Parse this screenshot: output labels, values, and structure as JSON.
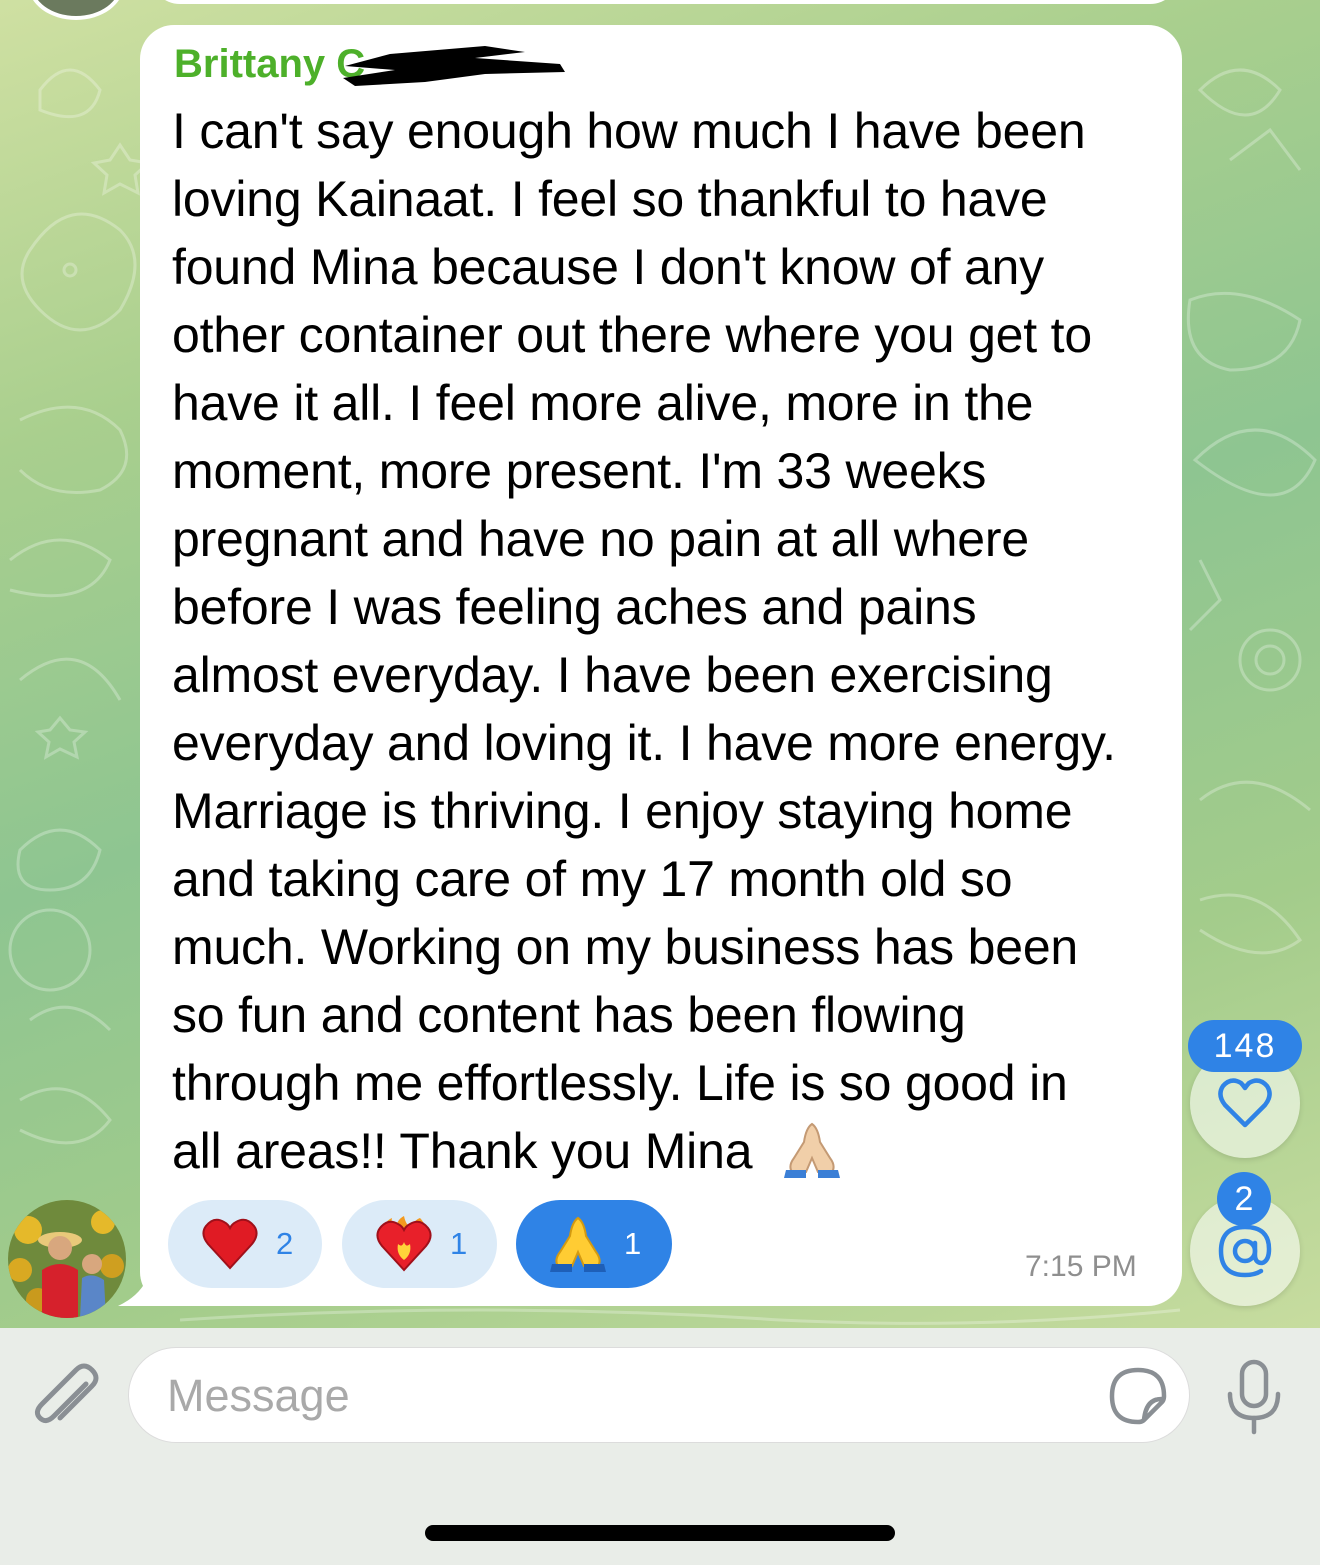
{
  "chat": {
    "message": {
      "sender": "Brittany C",
      "lines": [
        "I can't say enough how much I have been",
        "loving Kainaat. I feel so thankful to have",
        "found Mina because I don't know of any",
        "other container out there where you get to",
        "have it all. I feel more alive, more in the",
        "moment, more present. I'm 33 weeks",
        "pregnant and have no pain at all where",
        "before I was feeling aches and pains",
        "almost everyday. I have been exercising",
        "everyday and loving it. I have more energy.",
        "Marriage is thriving. I enjoy staying home",
        "and taking care of my 17 month old so",
        "much. Working on my business has been",
        "so fun and content has been flowing",
        "through me effortlessly. Life is so good in",
        "all areas!! Thank you Mina"
      ],
      "time": "7:15 PM",
      "reactions": [
        {
          "emoji": "red-heart",
          "count": "2",
          "selected": false
        },
        {
          "emoji": "heart-on-fire",
          "count": "1",
          "selected": false
        },
        {
          "emoji": "folded-hands",
          "count": "1",
          "selected": true
        }
      ]
    },
    "side_buttons": {
      "reactions_badge": "148",
      "mentions_badge": "2",
      "reactions_icon": "heart-outline-icon",
      "mentions_icon": "at-icon"
    }
  },
  "input_bar": {
    "placeholder": "Message",
    "attach_icon": "paperclip-icon",
    "sticker_icon": "sticker-icon",
    "voice_icon": "microphone-icon"
  },
  "colors": {
    "accent": "#2f83e6",
    "sender_name": "#4db02a",
    "reaction_bg": "#dcebf8",
    "timestamp": "#8f8f8f"
  }
}
